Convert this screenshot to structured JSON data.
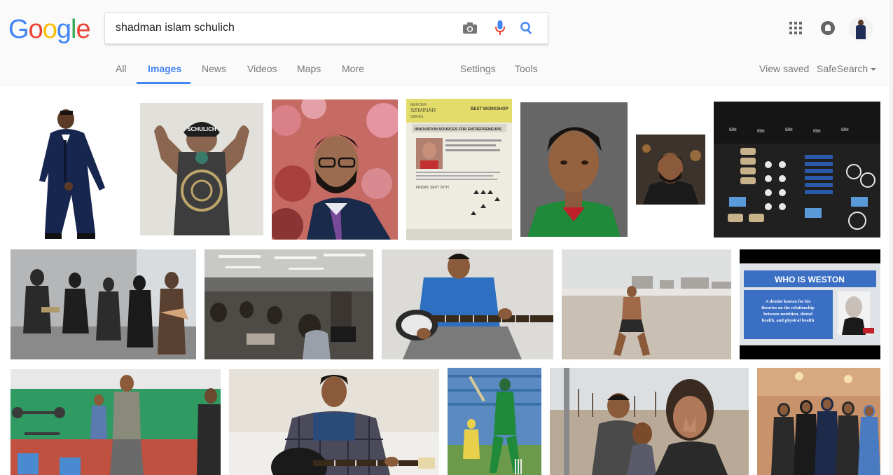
{
  "logo": {
    "letters": [
      "G",
      "o",
      "o",
      "g",
      "l",
      "e"
    ]
  },
  "search": {
    "query": "shadman islam schulich"
  },
  "tabs": [
    {
      "label": "All"
    },
    {
      "label": "Images"
    },
    {
      "label": "News"
    },
    {
      "label": "Videos"
    },
    {
      "label": "Maps"
    },
    {
      "label": "More"
    }
  ],
  "tools": {
    "settings": "Settings",
    "tools": "Tools",
    "view_saved": "View saved",
    "safesearch": "SafeSearch"
  },
  "results": {
    "seminar": {
      "banner_line1": "MERCIER",
      "banner_line2": "SEMINAR",
      "banner_line3": "SERIES",
      "tag": "BEST WORKSHOP",
      "title": "INNOVATION SOURCES FOR ENTREPRENEURS",
      "date": "FRIDAY, SEPT 20TH"
    },
    "weston": {
      "title": "WHO IS WESTON",
      "body_line1": "A dentist known for his",
      "body_line2": "theories on the relationship",
      "body_line3": "between nutrition, dental",
      "body_line4": "health, and physical health"
    },
    "ibm_label": "IBM",
    "cap_text": "SCHULICH"
  },
  "colors": {
    "brand_blue": "#4285f4",
    "brand_red": "#ea4335",
    "brand_yellow": "#fbbc05",
    "brand_green": "#34a853"
  }
}
